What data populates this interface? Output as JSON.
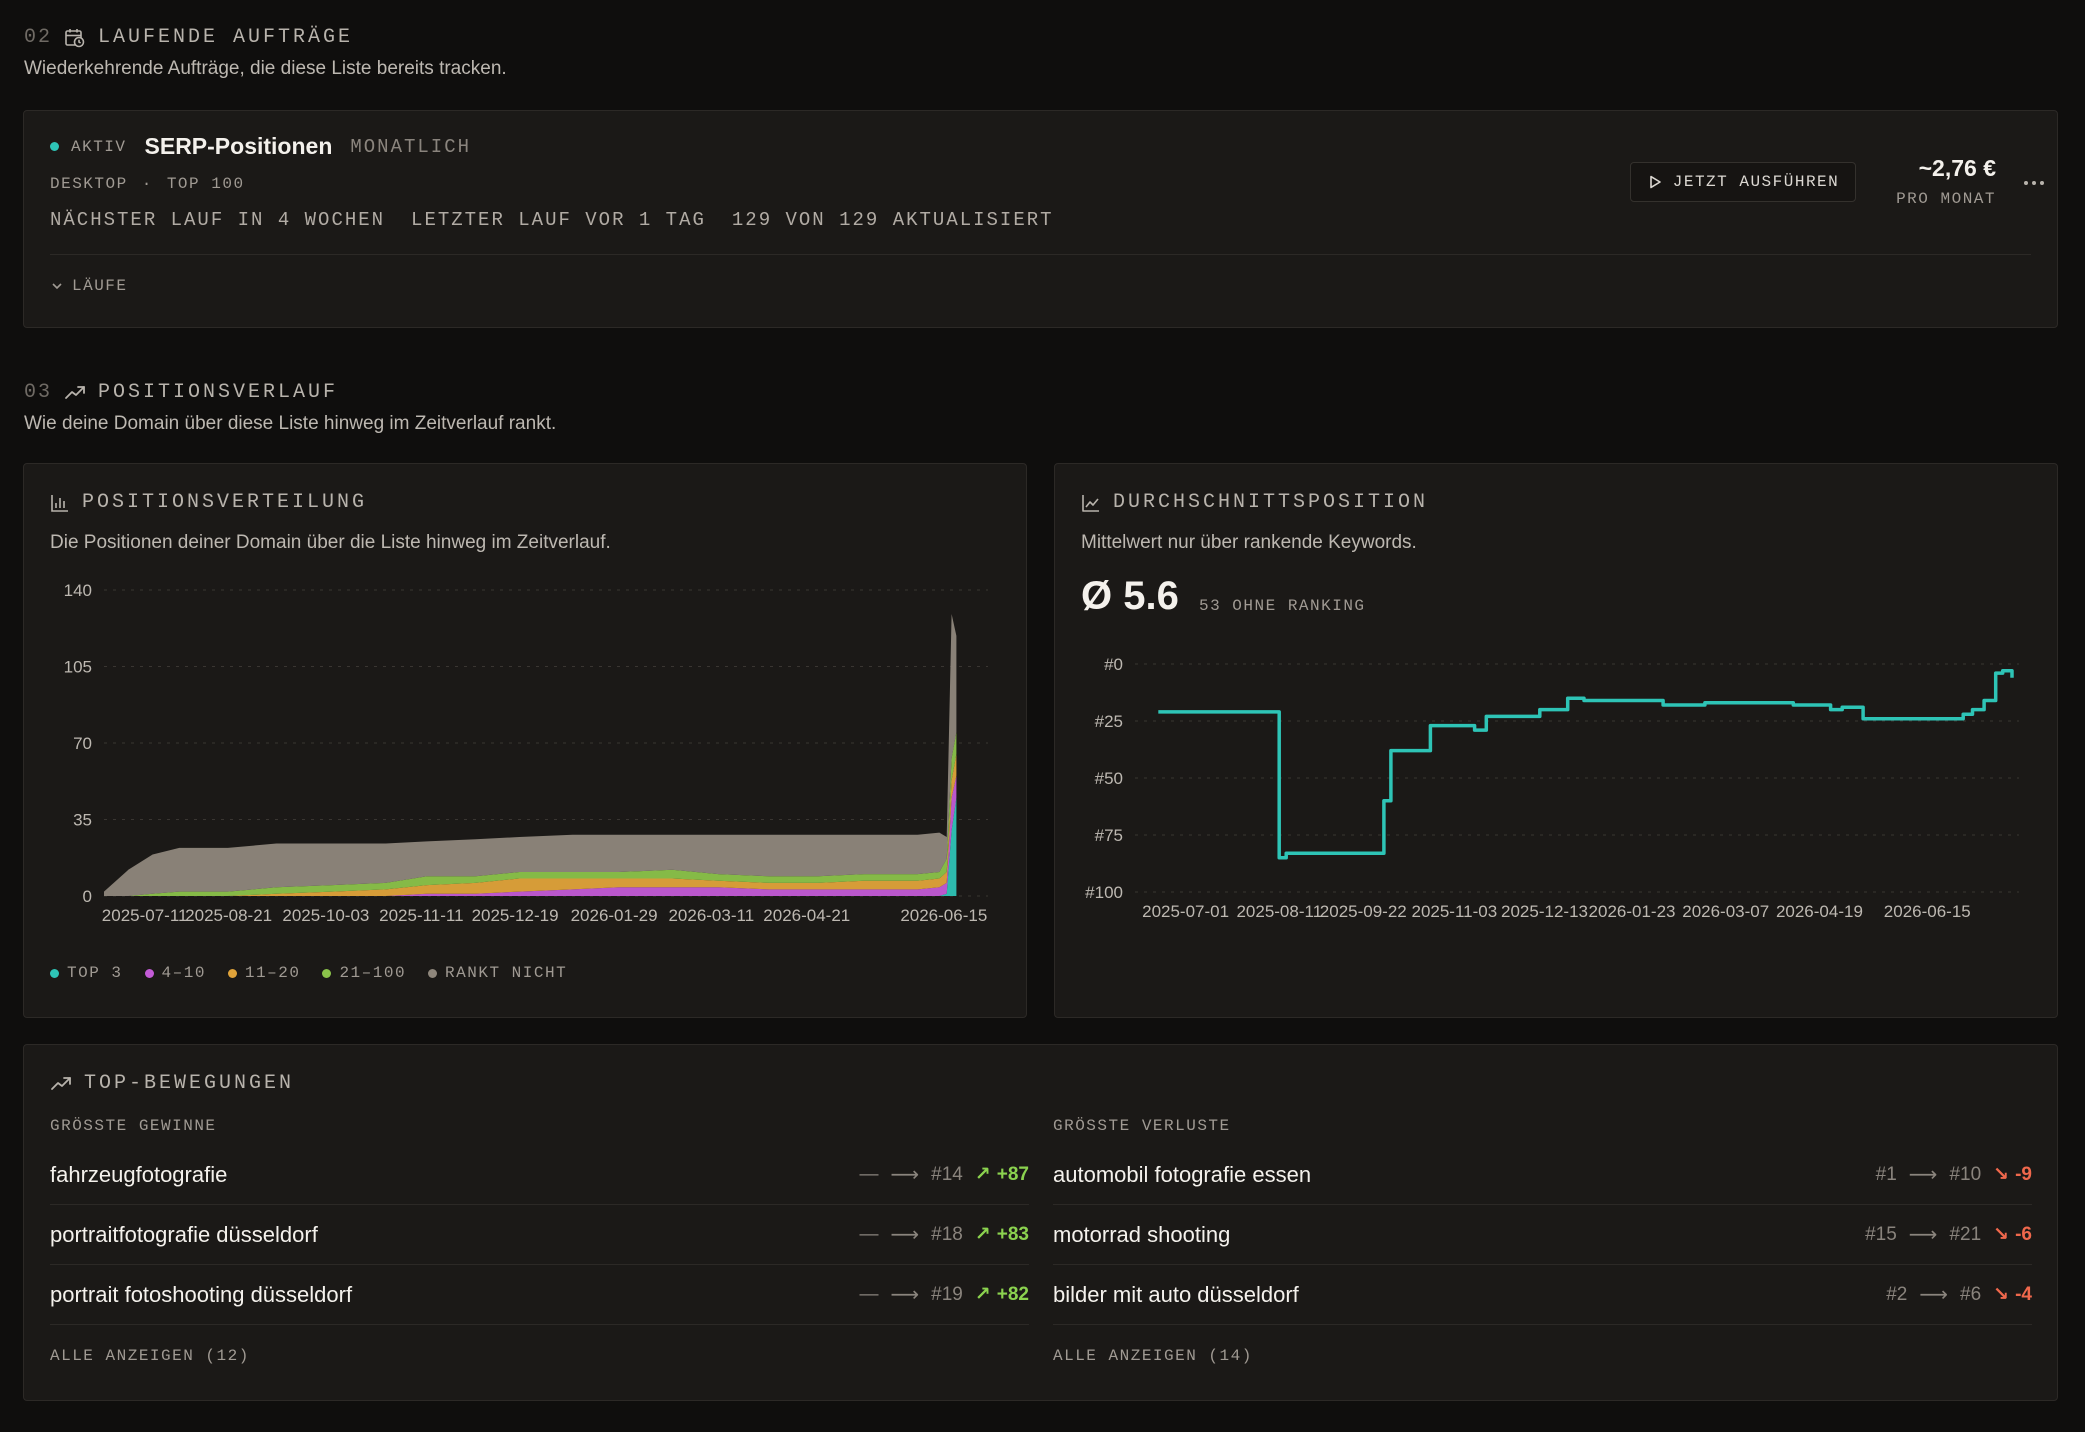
{
  "section_jobs": {
    "num": "02",
    "title": "LAUFENDE AUFTRÄGE",
    "subtitle": "Wiederkehrende Aufträge, die diese Liste bereits tracken."
  },
  "job": {
    "status": "AKTIV",
    "status_color": "#2ec4b6",
    "title": "SERP-Positionen",
    "frequency": "MONATLICH",
    "device": "DESKTOP",
    "separator": "·",
    "scope": "TOP 100",
    "next_run": "NÄCHSTER LAUF IN 4 WOCHEN",
    "last_run": "LETZTER LAUF VOR 1 TAG",
    "updated": "129 VON 129 AKTUALISIERT",
    "runs_label": "LÄUFE",
    "run_button": "JETZT AUSFÜHREN",
    "price": "~2,76 €",
    "price_sub": "PRO MONAT"
  },
  "section_history": {
    "num": "03",
    "title": "POSITIONSVERLAUF",
    "subtitle": "Wie deine Domain über diese Liste hinweg im Zeitverlauf rankt."
  },
  "distribution": {
    "title": "POSITIONSVERTEILUNG",
    "subtitle": "Die Positionen deiner Domain über die Liste hinweg im Zeitverlauf."
  },
  "average": {
    "title": "DURCHSCHNITTSPOSITION",
    "subtitle": "Mittelwert nur über rankende Keywords.",
    "value": "Ø 5.6",
    "unranked": "53 OHNE RANKING"
  },
  "chart_data": [
    {
      "type": "area",
      "stacked": true,
      "x_tick_labels": [
        "2025-07-11",
        "2025-08-21",
        "2025-10-03",
        "2025-11-11",
        "2025-12-19",
        "2026-01-29",
        "2026-03-11",
        "2026-04-21",
        "2026-06-15"
      ],
      "y_ticks": [
        0,
        35,
        70,
        105,
        140
      ],
      "ylim": [
        0,
        140
      ],
      "xlim": [
        "2025-07-01",
        "2026-06-30"
      ],
      "grid": true,
      "legend_position": "bottom-left",
      "x": [
        "2025-07-01",
        "2025-07-11",
        "2025-07-21",
        "2025-08-01",
        "2025-08-21",
        "2025-09-10",
        "2025-10-03",
        "2025-10-25",
        "2025-11-11",
        "2025-12-01",
        "2025-12-19",
        "2026-01-10",
        "2026-01-29",
        "2026-02-20",
        "2026-03-11",
        "2026-04-01",
        "2026-04-21",
        "2026-05-10",
        "2026-06-01",
        "2026-06-10",
        "2026-06-13",
        "2026-06-15",
        "2026-06-17"
      ],
      "series": [
        {
          "name": "TOP 3",
          "color": "#2ec4b6",
          "values": [
            0,
            0,
            0,
            0,
            0,
            0,
            0,
            0,
            0,
            0,
            0,
            0,
            0,
            0,
            0,
            0,
            0,
            0,
            0,
            0,
            1,
            30,
            45
          ]
        },
        {
          "name": "4–10",
          "color": "#c35bd6",
          "values": [
            0,
            0,
            0,
            0,
            0,
            0,
            0,
            0,
            1,
            1,
            2,
            3,
            4,
            4,
            4,
            3,
            3,
            3,
            3,
            4,
            5,
            15,
            10
          ]
        },
        {
          "name": "11–20",
          "color": "#e0a33a",
          "values": [
            0,
            0,
            0,
            0,
            0,
            1,
            2,
            3,
            4,
            5,
            6,
            5,
            4,
            4,
            3,
            3,
            3,
            4,
            4,
            4,
            5,
            8,
            10
          ]
        },
        {
          "name": "21–100",
          "color": "#8bc34a",
          "values": [
            0,
            0,
            1,
            2,
            2,
            3,
            3,
            3,
            4,
            3,
            3,
            3,
            3,
            4,
            3,
            3,
            3,
            3,
            3,
            3,
            6,
            10,
            10
          ]
        },
        {
          "name": "RANKT NICHT",
          "color": "#8f877c",
          "values": [
            2,
            12,
            18,
            20,
            20,
            20,
            19,
            18,
            16,
            17,
            16,
            17,
            17,
            16,
            18,
            19,
            19,
            18,
            18,
            18,
            10,
            66,
            44
          ]
        }
      ]
    },
    {
      "type": "line",
      "x_tick_labels": [
        "2025-07-01",
        "2025-08-11",
        "2025-09-22",
        "2025-11-03",
        "2025-12-13",
        "2026-01-23",
        "2026-03-07",
        "2026-04-19",
        "2026-06-15"
      ],
      "y_tick_labels": [
        "#0",
        "#25",
        "#50",
        "#75",
        "#100"
      ],
      "ylim": [
        0,
        100
      ],
      "y_inverted": true,
      "xlim": [
        "2025-06-10",
        "2026-06-25"
      ],
      "grid": true,
      "color": "#2ec4b6",
      "x": [
        "2025-06-20",
        "2025-07-20",
        "2025-08-10",
        "2025-08-11",
        "2025-08-14",
        "2025-09-22",
        "2025-09-25",
        "2025-09-28",
        "2025-10-02",
        "2025-10-15",
        "2025-10-20",
        "2025-11-03",
        "2025-11-08",
        "2025-11-20",
        "2025-12-01",
        "2025-12-13",
        "2025-12-20",
        "2026-01-10",
        "2026-01-23",
        "2026-02-10",
        "2026-03-07",
        "2026-03-20",
        "2026-04-01",
        "2026-04-05",
        "2026-04-10",
        "2026-04-19",
        "2026-05-10",
        "2026-05-20",
        "2026-06-01",
        "2026-06-05",
        "2026-06-10",
        "2026-06-15",
        "2026-06-18",
        "2026-06-22"
      ],
      "values": [
        21,
        21,
        21,
        85,
        83,
        83,
        60,
        38,
        38,
        27,
        27,
        29,
        23,
        23,
        20,
        15,
        16,
        16,
        18,
        17,
        17,
        18,
        18,
        20,
        19,
        24,
        24,
        24,
        22,
        20,
        16,
        4,
        3,
        6
      ]
    }
  ],
  "legend": [
    {
      "label": "TOP 3",
      "color": "#2ec4b6"
    },
    {
      "label": "4–10",
      "color": "#c35bd6"
    },
    {
      "label": "11–20",
      "color": "#e0a33a"
    },
    {
      "label": "21–100",
      "color": "#8bc34a"
    },
    {
      "label": "RANKT NICHT",
      "color": "#8f877c"
    }
  ],
  "movements": {
    "title": "TOP-BEWEGUNGEN",
    "gains": {
      "title": "GRÖSSTE GEWINNE",
      "items": [
        {
          "keyword": "fahrzeugfotografie",
          "from": "—",
          "to": "#14",
          "delta": "+87"
        },
        {
          "keyword": "portraitfotografie düsseldorf",
          "from": "—",
          "to": "#18",
          "delta": "+83"
        },
        {
          "keyword": "portrait fotoshooting düsseldorf",
          "from": "—",
          "to": "#19",
          "delta": "+82"
        }
      ],
      "show_all": "ALLE ANZEIGEN (12)"
    },
    "losses": {
      "title": "GRÖSSTE VERLUSTE",
      "items": [
        {
          "keyword": "automobil fotografie essen",
          "from": "#1",
          "to": "#10",
          "delta": "-9"
        },
        {
          "keyword": "motorrad shooting",
          "from": "#15",
          "to": "#21",
          "delta": "-6"
        },
        {
          "keyword": "bilder mit auto düsseldorf",
          "from": "#2",
          "to": "#6",
          "delta": "-4"
        }
      ],
      "show_all": "ALLE ANZEIGEN (14)"
    }
  }
}
